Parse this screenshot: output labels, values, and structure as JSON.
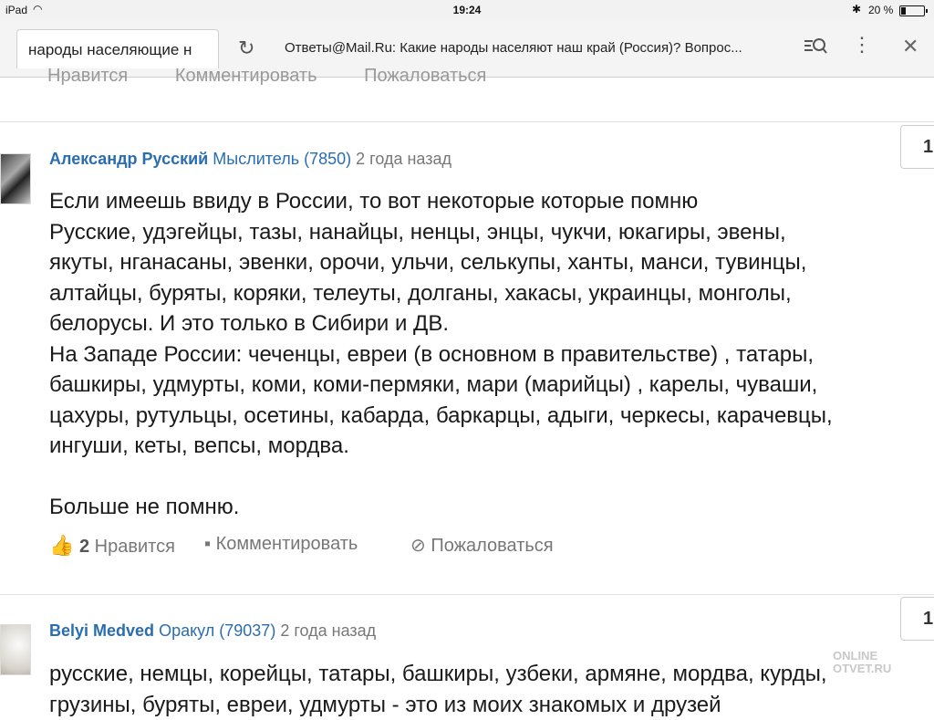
{
  "status_bar": {
    "device": "iPad",
    "time": "19:24",
    "battery": "20 %",
    "battery_level": 0.2
  },
  "browser": {
    "search_tab": "народы населяющие н",
    "page_title": "Ответы@Mail.Ru: Какие народы населяют наш край (Россия)? Вопрос..."
  },
  "previous_answer_actions": {
    "like": "Нравится",
    "comment": "Комментировать",
    "report": "Пожаловаться"
  },
  "answers": [
    {
      "author": "Александр Русский",
      "rank": "Мыслитель (7850)",
      "time": "2 года назад",
      "rating": "1",
      "lines": [
        "Если имеешь ввиду в России, то вот некоторые которые помню",
        "Русские, удэгейцы, тазы, нанайцы, ненцы, энцы, чукчи, юкагиры, эвены,",
        "якуты, нганасаны, эвенки, орочи, ульчи, селькупы, ханты, манси, тувинцы,",
        "алтайцы, буряты, коряки, телеуты, долганы, хакасы, украинцы, монголы,",
        "белорусы. И это только в Сибири и ДВ.",
        "На Западе России: чеченцы, евреи (в основном в правительстве) , татары,",
        "башкиры, удмурты, коми, коми-пермяки, мари (марийцы) , карелы, чуваши,",
        "цахуры, рутульцы, осетины, кабарда, баркарцы, адыги, черкесы, карачевцы,",
        "ингуши, кеты, вепсы, мордва.",
        "",
        "Больше не помню."
      ],
      "likes": "2",
      "like_label": "Нравится",
      "comment_label": "Комментировать",
      "report_label": "Пожаловаться"
    },
    {
      "author": "Belyi Medved",
      "rank": "Оракул (79037)",
      "time": "2 года назад",
      "rating": "1",
      "lines": [
        "русские, немцы, корейцы, татары, башкиры, узбеки, армяне, мордва, курды,",
        "грузины, буряты, евреи, удмурты - это из моих знакомых и друзей"
      ]
    }
  ],
  "watermark": {
    "line1": "ONLINE",
    "line2": "OTVET.RU"
  }
}
